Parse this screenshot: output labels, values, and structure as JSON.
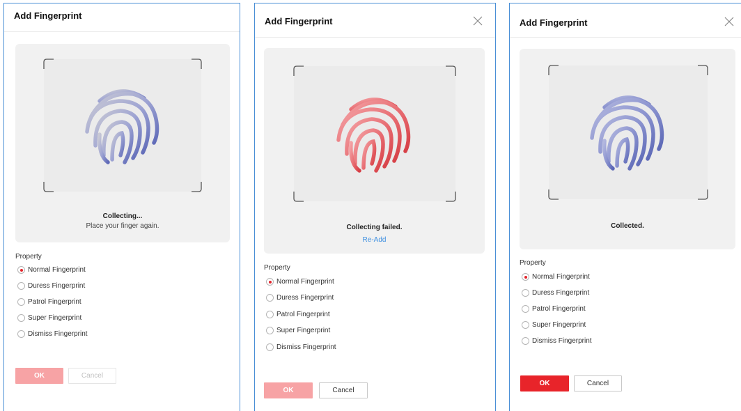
{
  "dialogs": [
    {
      "title": "Add Fingerprint",
      "status": "Collecting...",
      "hint": "Place your finger again.",
      "property_label": "Property",
      "options": [
        "Normal Fingerprint",
        "Duress Fingerprint",
        "Patrol Fingerprint",
        "Super Fingerprint",
        "Dismiss Fingerprint"
      ],
      "selected": "Normal Fingerprint",
      "ok_label": "OK",
      "cancel_label": "Cancel"
    },
    {
      "title": "Add Fingerprint",
      "status": "Collecting failed.",
      "link": "Re-Add",
      "property_label": "Property",
      "options": [
        "Normal Fingerprint",
        "Duress Fingerprint",
        "Patrol Fingerprint",
        "Super Fingerprint",
        "Dismiss Fingerprint"
      ],
      "selected": "Normal Fingerprint",
      "ok_label": "OK",
      "cancel_label": "Cancel"
    },
    {
      "title": "Add Fingerprint",
      "status": "Collected.",
      "property_label": "Property",
      "options": [
        "Normal Fingerprint",
        "Duress Fingerprint",
        "Patrol Fingerprint",
        "Super Fingerprint",
        "Dismiss Fingerprint"
      ],
      "selected": "Normal Fingerprint",
      "ok_label": "OK",
      "cancel_label": "Cancel"
    }
  ],
  "colors": {
    "accent_red": "#e8242a",
    "accent_red_disabled": "#f7a3a5",
    "link_blue": "#3d8fe0",
    "fingerprint_collecting": "#7b84c4",
    "fingerprint_failed": "#e05a60",
    "fingerprint_collected": "#6f7ac0"
  },
  "icons": {
    "close": "close-icon",
    "fingerprint": "fingerprint-icon"
  }
}
